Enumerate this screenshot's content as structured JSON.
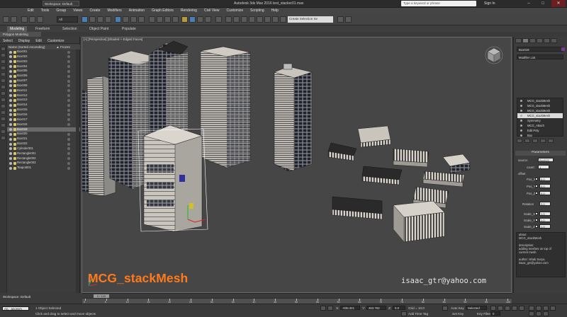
{
  "titlebar": {
    "workspace": "Workspace: Default",
    "title": "Autodesk 3ds Max 2016   test_stacker01.max",
    "search_placeholder": "Type a keyword or phrase",
    "signin": "Sign In",
    "minimize": "–",
    "maximize": "□",
    "close": "✕"
  },
  "menu": [
    "Edit",
    "Tools",
    "Group",
    "Views",
    "Create",
    "Modifiers",
    "Animation",
    "Graph Editors",
    "Rendering",
    "Civil View",
    "Customize",
    "Scripting",
    "Help"
  ],
  "toolbar": {
    "selection_filter": "All",
    "named_selection": "Create Selection Se"
  },
  "ribbon": {
    "tabs": [
      "Modeling",
      "Freeform",
      "Selection",
      "Object Paint",
      "Populate"
    ],
    "active_tab": "Modeling",
    "sub": "Polygon Modeling"
  },
  "scene_explorer": {
    "tabs": [
      "Select",
      "Display",
      "Edit",
      "Customize"
    ],
    "header": "Name (Sorted Ascending)",
    "frozen_header": "▲ Frozen",
    "items": [
      "Box001",
      "Box002",
      "Box003",
      "Box004",
      "Box005",
      "Box006",
      "Box007",
      "Box008",
      "Box011",
      "Box012",
      "Box013",
      "Box014",
      "Box015",
      "Box016",
      "Box017",
      "Box018",
      "Box019",
      "Box020",
      "Box021",
      "Box022",
      "Cylinder001",
      "Rectangle001",
      "Rectangle002",
      "Rectangle003",
      "Teapot001"
    ],
    "selected_item": "Box019",
    "workspace": "Workspace: Default"
  },
  "viewport": {
    "label": "[+] [Perspective] [Shaded + Edged Faces]"
  },
  "overlay": {
    "title": "MCG_stackMesh",
    "email": "isaac_gtr@yahoo.com"
  },
  "command_panel": {
    "object_name": "Box019",
    "modifier_list": "Modifier List",
    "stack": [
      "MCG_stackMesh",
      "MCG_stackMesh",
      "MCG_stackMesh",
      "MCG_stackMesh",
      "Symmetry",
      "MCG_Attach",
      "Edit Poly",
      "Box"
    ],
    "stack_selected_index": 3,
    "rollout": "Parameters",
    "source_label": "source:",
    "source_value": "Box019",
    "count_label": "count:",
    "count_value": "1",
    "offset_label": "offset",
    "pos_x_label": "Pos_X",
    "pos_x": "0.0",
    "pos_y_label": "Pos_Y",
    "pos_y": "0.0",
    "pos_z_label": "Pos_Z",
    "pos_z": "0.0",
    "rotation_label": "Rotation",
    "rotation": "0.0",
    "scale_x_label": "Scale_X",
    "scale_x": "1.0",
    "scale_y_label": "Scale_Y",
    "scale_y": "1.0",
    "scale_z_label": "Scale_Z",
    "scale_z": "1.0",
    "about_header": "about",
    "about_lines": [
      "MCG_stackMesh",
      "",
      "description:",
      "adding meshes on top of",
      "current mesh",
      "",
      "author: Ishak Suryo,",
      "isaac_gtr@yahoo.com"
    ]
  },
  "timeline": {
    "slider_label": "0 / 100",
    "ticks": [
      "0",
      "5",
      "10",
      "15",
      "20",
      "25",
      "30",
      "35",
      "40",
      "45",
      "50",
      "55",
      "60",
      "65",
      "70",
      "75",
      "80",
      "85",
      "90",
      "95",
      "100"
    ]
  },
  "status": {
    "maxscript": "AC _anonym",
    "selected": "1 Object Selected",
    "prompt": "Click and drag to select and move objects",
    "x_label": "X:",
    "x_value": "-836.321",
    "y_label": "Y:",
    "y_value": "463.753",
    "z_label": "Z:",
    "z_value": "0.0",
    "grid": "Grid = 10.0",
    "add_time_tag": "Add Time Tag",
    "auto_key": "Auto Key",
    "set_key": "Set Key",
    "key_filter_value": "Selected",
    "key_filters": "Key Filters...",
    "frame": "0"
  }
}
